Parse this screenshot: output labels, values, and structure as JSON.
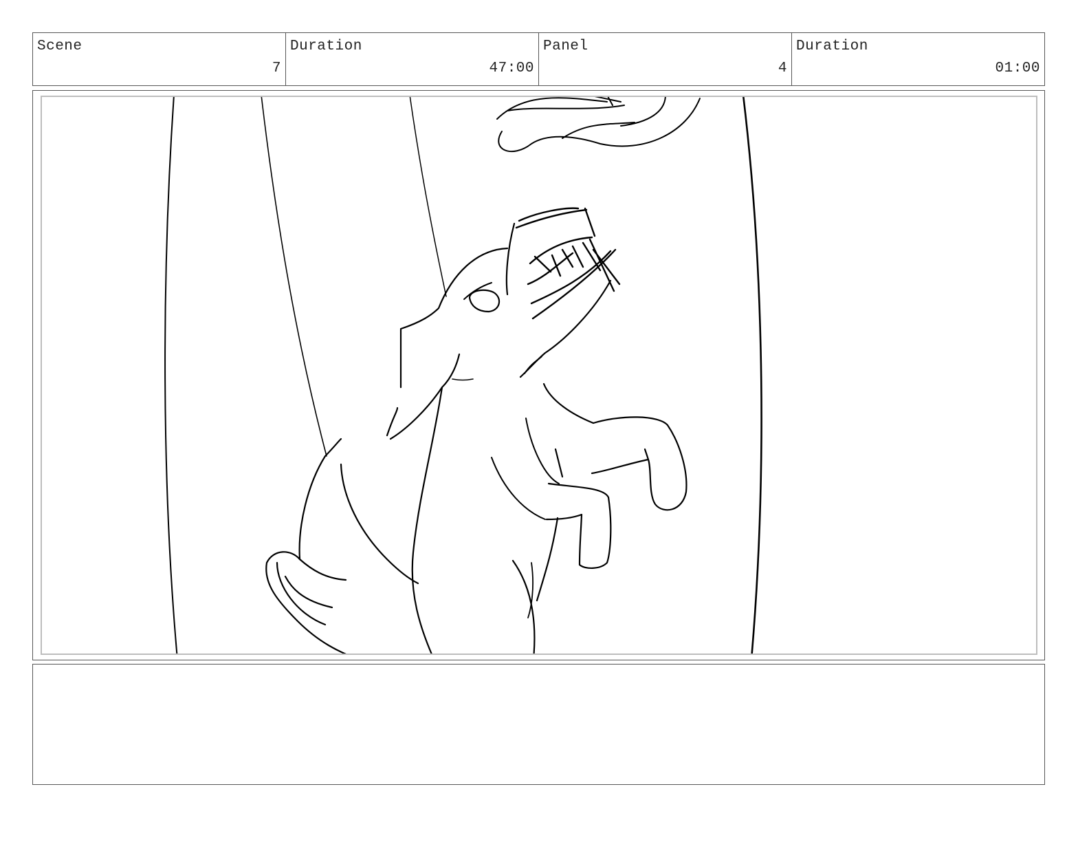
{
  "header": {
    "scene_label": "Scene",
    "scene_value": "7",
    "scene_duration_label": "Duration",
    "scene_duration_value": "47:00",
    "panel_label": "Panel",
    "panel_value": "4",
    "panel_duration_label": "Duration",
    "panel_duration_value": "01:00"
  },
  "notes": {
    "text": ""
  }
}
